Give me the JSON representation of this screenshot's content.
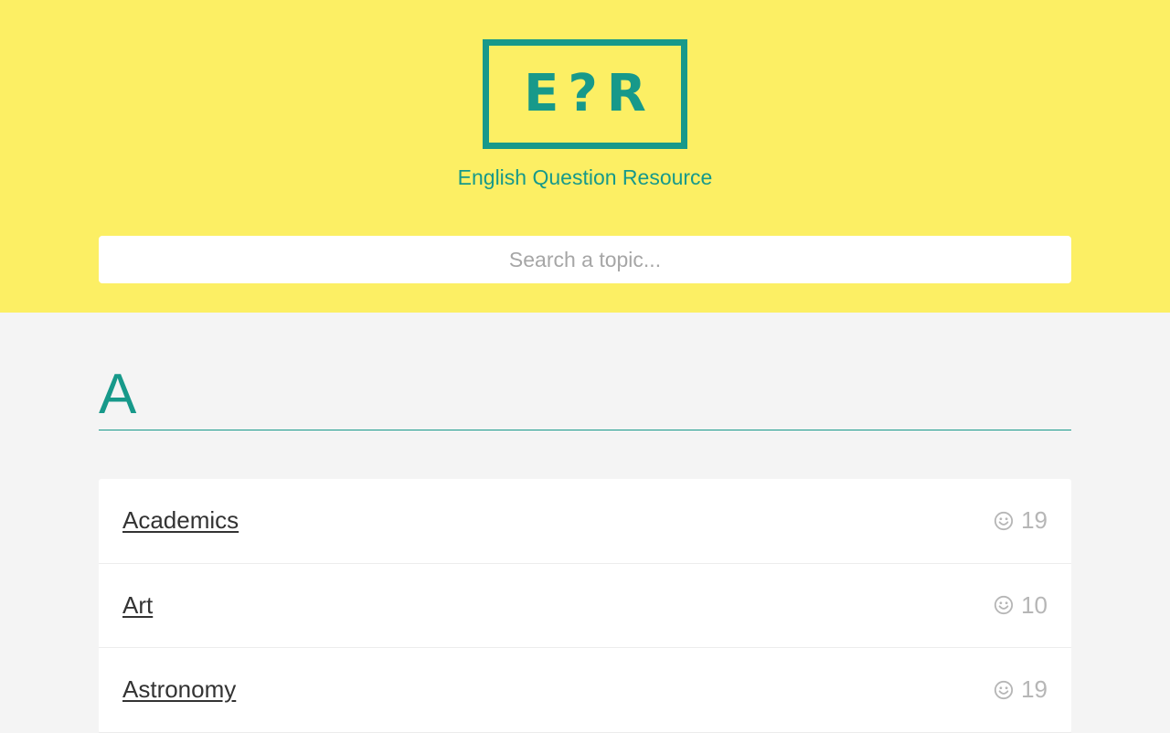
{
  "header": {
    "logo_text": "E?R",
    "tagline": "English Question Resource",
    "background_color": "#fcef64",
    "accent_color": "#17998a"
  },
  "search": {
    "placeholder": "Search a topic...",
    "value": ""
  },
  "section": {
    "letter": "A"
  },
  "topics": [
    {
      "label": "Academics",
      "count": "19",
      "icon": "smiley-icon"
    },
    {
      "label": "Art",
      "count": "10",
      "icon": "smiley-icon"
    },
    {
      "label": "Astronomy",
      "count": "19",
      "icon": "smiley-icon"
    }
  ]
}
